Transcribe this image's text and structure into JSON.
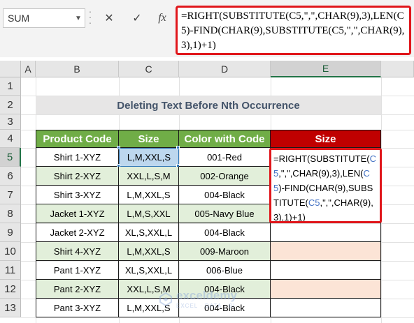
{
  "formula_bar": {
    "name_box": "SUM",
    "cancel_icon": "✕",
    "enter_icon": "✓",
    "fx_label": "fx",
    "formula": "=RIGHT(SUBSTITUTE(C5,\",\",CHAR(9),3),LEN(C5)-FIND(CHAR(9),SUBSTITUTE(C5,\",\",CHAR(9),3),1)+1)"
  },
  "columns": [
    "A",
    "B",
    "C",
    "D",
    "E"
  ],
  "rows": [
    "1",
    "2",
    "3",
    "4",
    "5",
    "6",
    "7",
    "8",
    "9",
    "10",
    "11",
    "12",
    "13"
  ],
  "title": "Deleting Text Before Nth Occurrence",
  "table": {
    "headers": [
      "Product Code",
      "Size",
      "Color with Code",
      "Size"
    ],
    "rows": [
      [
        "Shirt 1-XYZ",
        "L,M,XXL,S",
        "001-Red"
      ],
      [
        "Shirt 2-XYZ",
        "XXL,L,S,M",
        "002-Orange"
      ],
      [
        "Shirt 3-XYZ",
        "L,M,XXL,S",
        "004-Black"
      ],
      [
        "Jacket 1-XYZ",
        "L,M,S,XXL",
        "005-Navy Blue"
      ],
      [
        "Jacket 2-XYZ",
        "XL,S,XXL,L",
        "004-Black"
      ],
      [
        "Shirt 4-XYZ",
        "L,M,XXL,S",
        "009-Maroon"
      ],
      [
        "Pant 1-XYZ",
        "XL,S,XXL,L",
        "006-Blue"
      ],
      [
        "Pant 2-XYZ",
        "XXL,L,S,M",
        "004-Black"
      ],
      [
        "Pant 3-XYZ",
        "L,M,XXL,S",
        "004-Black"
      ]
    ]
  },
  "edit_cell": {
    "p1": "=RIGHT(SUBSTITUTE(",
    "ref1": "C5",
    "p2": ",\",\",CHAR(9),3),LEN(",
    "ref2": "C5",
    "p3": ")-FIND(CHAR(9),SUBSTITUTE(",
    "ref3": "C5",
    "p4": ",\",\",CHAR(9),3),1)+1)"
  },
  "watermark": {
    "name": "exceldemy",
    "tagline": "EXCEL · DATA · BI"
  },
  "colors": {
    "header_green": "#70ad47",
    "header_red": "#c00000",
    "row_alt": "#e2efda",
    "row_peach": "#fce4d6",
    "highlight_border": "#e0161b",
    "selected_cell": "#bdd7ee"
  }
}
